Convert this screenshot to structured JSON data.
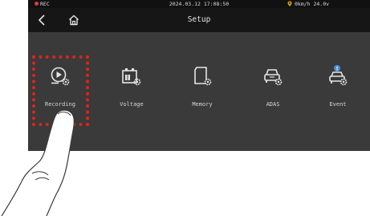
{
  "status_bar": {
    "rec_label": "REC",
    "datetime": "2024.03.12 17:08:50",
    "speed_voltage": "0km/h 24.0v"
  },
  "header": {
    "back_icon": "chevron-left-icon",
    "home_icon": "home-icon",
    "title": "Setup"
  },
  "menu": {
    "items": [
      {
        "label": "Recording",
        "icon": "recording-gear-icon",
        "selected": true
      },
      {
        "label": "Voltage",
        "icon": "battery-gear-icon"
      },
      {
        "label": "Memory",
        "icon": "sd-card-gear-icon"
      },
      {
        "label": "ADAS",
        "icon": "car-gear-icon"
      },
      {
        "label": "Event",
        "icon": "car-alert-gear-icon"
      }
    ]
  },
  "colors": {
    "screen_bg": "#3a3a3a",
    "bar_bg": "#161616",
    "highlight": "#d6281e",
    "event_badge": "#4a90d9",
    "rec_dot": "#e53935"
  }
}
